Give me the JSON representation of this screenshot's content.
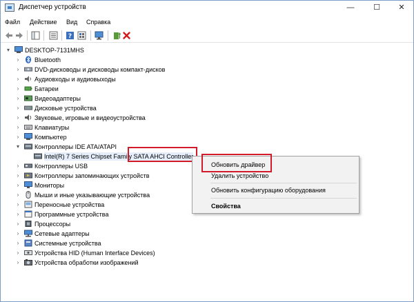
{
  "window": {
    "title": "Диспетчер устройств",
    "controls": {
      "minimize": "—",
      "maximize": "☐",
      "close": "✕"
    }
  },
  "menu": [
    "Файл",
    "Действие",
    "Вид",
    "Справка"
  ],
  "tree": {
    "root": "DESKTOP-7131MHS",
    "items": [
      "Bluetooth",
      "DVD-дисководы и дисководы компакт-дисков",
      "Аудиовходы и аудиовыходы",
      "Батареи",
      "Видеоадаптеры",
      "Дисковые устройства",
      "Звуковые, игровые и видеоустройства",
      "Клавиатуры",
      "Компьютер",
      "Контроллеры IDE ATA/ATAPI",
      "Intel(R) 7 Series Chipset Family SATA AHCI Controller",
      "Контроллеры USB",
      "Контроллеры запоминающих устройств",
      "Мониторы",
      "Мыши и иные указывающие устройства",
      "Переносные устройства",
      "Программные устройства",
      "Процессоры",
      "Сетевые адаптеры",
      "Системные устройства",
      "Устройства HID (Human Interface Devices)",
      "Устройства обработки изображений"
    ]
  },
  "context_menu": {
    "update_driver": "Обновить драйвер",
    "remove_device": "Удалить устройство",
    "scan_hardware": "Обновить конфигурацию оборудования",
    "properties": "Свойства"
  },
  "colors": {
    "highlight_box": "#d21a2a",
    "selection": "#e5eefa",
    "window_border": "#7a9cc6"
  }
}
